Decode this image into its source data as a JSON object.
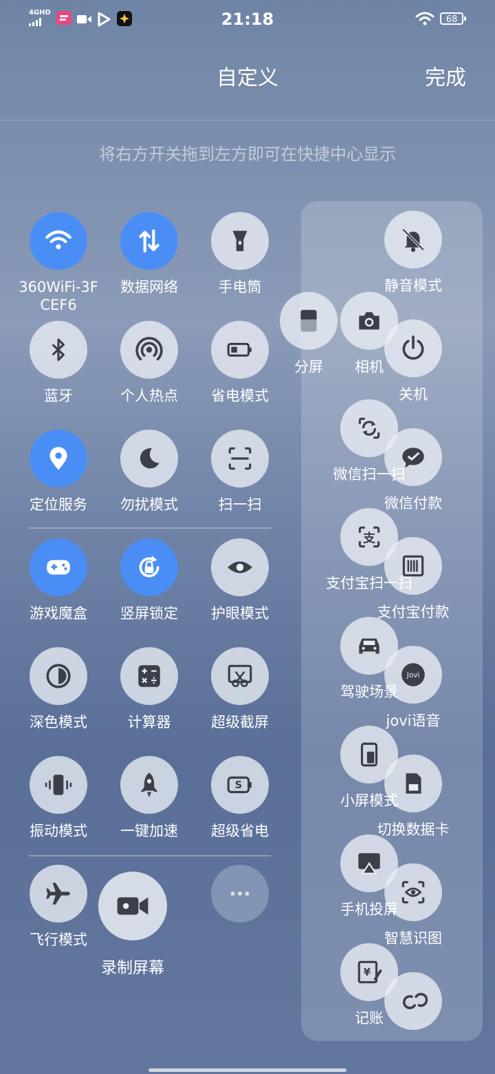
{
  "status": {
    "network": "4GHD",
    "time": "21:18",
    "battery": "68"
  },
  "header": {
    "title": "自定义",
    "done_label": "完成"
  },
  "hint": "将右方开关拖到左方即可在快捷中心显示",
  "left_tiles": [
    {
      "label": "360WiFi-3F CEF6",
      "icon": "wifi-icon",
      "on": true
    },
    {
      "label": "数据网络",
      "icon": "data-network-icon",
      "on": true
    },
    {
      "label": "手电筒",
      "icon": "flashlight-icon",
      "on": false
    },
    {
      "label": "蓝牙",
      "icon": "bluetooth-icon",
      "on": false
    },
    {
      "label": "个人热点",
      "icon": "hotspot-icon",
      "on": false
    },
    {
      "label": "省电模式",
      "icon": "battery-saver-icon",
      "on": false
    },
    {
      "label": "定位服务",
      "icon": "location-icon",
      "on": true
    },
    {
      "label": "勿扰模式",
      "icon": "moon-icon",
      "on": false
    },
    {
      "label": "扫一扫",
      "icon": "scan-icon",
      "on": false
    },
    {
      "label": "游戏魔盒",
      "icon": "gamepad-icon",
      "on": true
    },
    {
      "label": "竖屏锁定",
      "icon": "rotation-lock-icon",
      "on": true
    },
    {
      "label": "护眼模式",
      "icon": "eye-icon",
      "on": false
    },
    {
      "label": "深色模式",
      "icon": "dark-mode-icon",
      "on": false
    },
    {
      "label": "计算器",
      "icon": "calculator-icon",
      "on": false
    },
    {
      "label": "超级截屏",
      "icon": "screenshot-icon",
      "on": false
    },
    {
      "label": "振动模式",
      "icon": "vibrate-icon",
      "on": false
    },
    {
      "label": "一键加速",
      "icon": "rocket-icon",
      "on": false
    },
    {
      "label": "超级省电",
      "icon": "super-saver-icon",
      "on": false
    },
    {
      "label": "飞行模式",
      "icon": "airplane-icon",
      "on": false
    },
    {
      "label": "录制屏幕",
      "icon": "record-screen-icon",
      "on": false
    },
    {
      "label": "",
      "icon": "more-icon",
      "on": false
    }
  ],
  "right_tiles": [
    {
      "label": "静音模式",
      "icon": "mute-bell-icon"
    },
    {
      "label": "分屏",
      "icon": "split-screen-icon"
    },
    {
      "label": "相机",
      "icon": "camera-icon"
    },
    {
      "label": "关机",
      "icon": "power-icon"
    },
    {
      "label": "微信扫一扫",
      "icon": "wechat-scan-icon"
    },
    {
      "label": "微信付款",
      "icon": "wechat-pay-icon"
    },
    {
      "label": "支付宝扫一扫",
      "icon": "alipay-scan-icon"
    },
    {
      "label": "支付宝付款",
      "icon": "alipay-pay-icon"
    },
    {
      "label": "驾驶场景",
      "icon": "car-icon"
    },
    {
      "label": "jovi语音",
      "icon": "jovi-icon"
    },
    {
      "label": "小屏模式",
      "icon": "small-screen-icon"
    },
    {
      "label": "切换数据卡",
      "icon": "sim-card-icon"
    },
    {
      "label": "手机投屏",
      "icon": "cast-icon"
    },
    {
      "label": "智慧识图",
      "icon": "smart-vision-icon"
    },
    {
      "label": "记账",
      "icon": "bookkeeping-icon"
    },
    {
      "label": "",
      "icon": "link-icon"
    }
  ],
  "colors": {
    "accent": "#4a8ef5",
    "tile_bg": "#e9ecf3",
    "icon_dark": "#3b3f48"
  }
}
